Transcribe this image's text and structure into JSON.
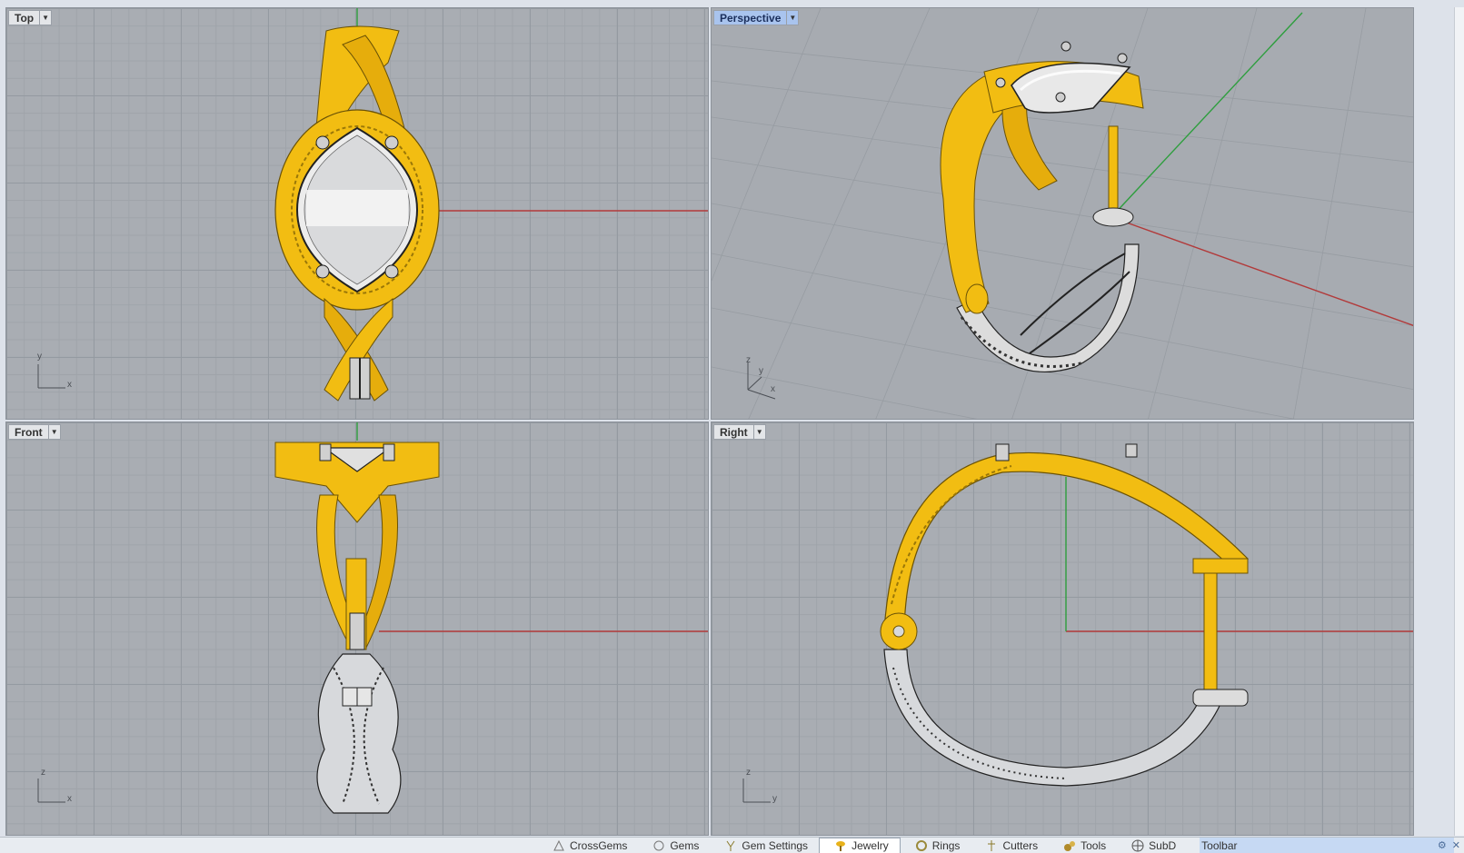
{
  "viewports": {
    "top": {
      "label": "Top",
      "axes": [
        "y",
        "x"
      ]
    },
    "perspective": {
      "label": "Perspective",
      "axes": [
        "z",
        "y",
        "x"
      ]
    },
    "front": {
      "label": "Front",
      "axes": [
        "z",
        "x"
      ]
    },
    "right": {
      "label": "Right",
      "axes": [
        "z",
        "y"
      ]
    }
  },
  "toolbar_tabs": [
    {
      "label": "CrossGems",
      "icon": "crossgems-icon"
    },
    {
      "label": "Gems",
      "icon": "gem-icon"
    },
    {
      "label": "Gem Settings",
      "icon": "prong-icon"
    },
    {
      "label": "Jewelry",
      "icon": "jewelry-icon",
      "active": true
    },
    {
      "label": "Rings",
      "icon": "ring-icon"
    },
    {
      "label": "Cutters",
      "icon": "cutter-icon"
    },
    {
      "label": "Tools",
      "icon": "tools-icon"
    },
    {
      "label": "SubD",
      "icon": "subd-icon"
    },
    {
      "label": "Toolbar",
      "icon": ""
    }
  ],
  "colors": {
    "gold": "#f2bd12",
    "silver": "#d7d9dc",
    "grid_bg": "#a9adb3",
    "axis_red": "#b23a3a",
    "axis_green": "#2e9e3e",
    "active_tab": "#a9c4ee"
  }
}
